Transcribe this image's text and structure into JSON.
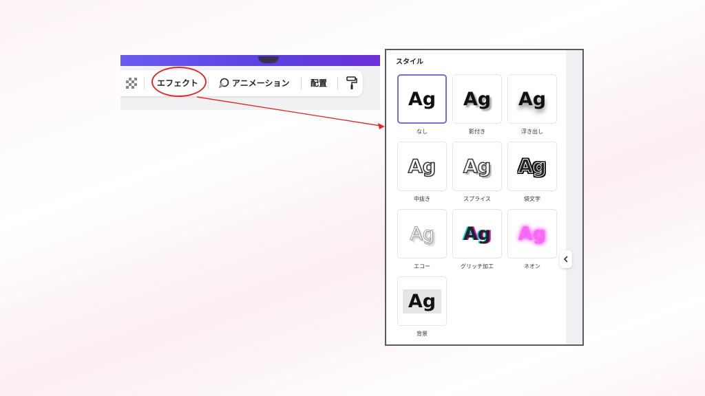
{
  "toolbar": {
    "effects_label": "エフェクト",
    "animation_label": "アニメーション",
    "position_label": "配置"
  },
  "panel": {
    "title": "スタイル",
    "styles": [
      {
        "label": "なし",
        "sample": "Ag",
        "selected": true
      },
      {
        "label": "影付き",
        "sample": "Ag"
      },
      {
        "label": "浮き出し",
        "sample": "Ag"
      },
      {
        "label": "中抜き",
        "sample": "Ag"
      },
      {
        "label": "スプライス",
        "sample": "Ag"
      },
      {
        "label": "袋文字",
        "sample": "Ag"
      },
      {
        "label": "エコー",
        "sample": "Ag"
      },
      {
        "label": "グリッチ加工",
        "sample": "Ag"
      },
      {
        "label": "ネオン",
        "sample": "Ag"
      },
      {
        "label": "背景",
        "sample": "Ag"
      }
    ]
  },
  "colors": {
    "highlight": "#e02b2b",
    "selected_border": "#7b6bd6",
    "header_gradient": "#5b3fe0"
  },
  "icons": {
    "transparency": "checkerboard-icon",
    "animation": "animation-icon",
    "copy_style": "paint-roller-icon",
    "collapse": "chevron-left-icon"
  }
}
